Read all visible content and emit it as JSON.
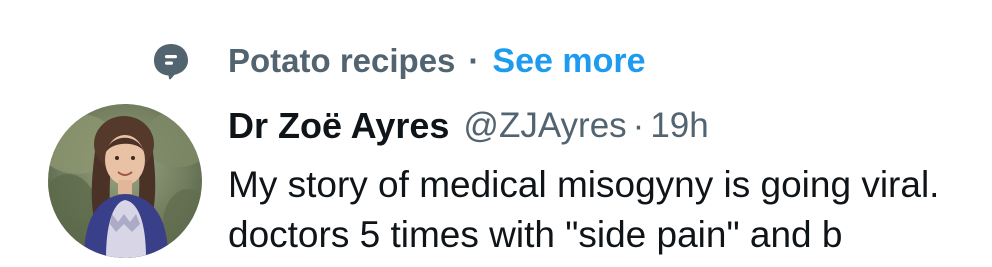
{
  "context": {
    "icon": "topic-icon",
    "label": "Potato recipes",
    "separator": "·",
    "see_more": "See more",
    "accent_color": "#1d9bf0"
  },
  "tweet": {
    "author": {
      "display_name": "Dr Zoë Ayres",
      "handle": "@ZJAyres",
      "avatar": "profile-photo"
    },
    "separator": "·",
    "timestamp": "19h",
    "text_lines": [
      "My story of medical misogyny is going viral.",
      "doctors 5 times with \"side pain\" and b"
    ]
  }
}
